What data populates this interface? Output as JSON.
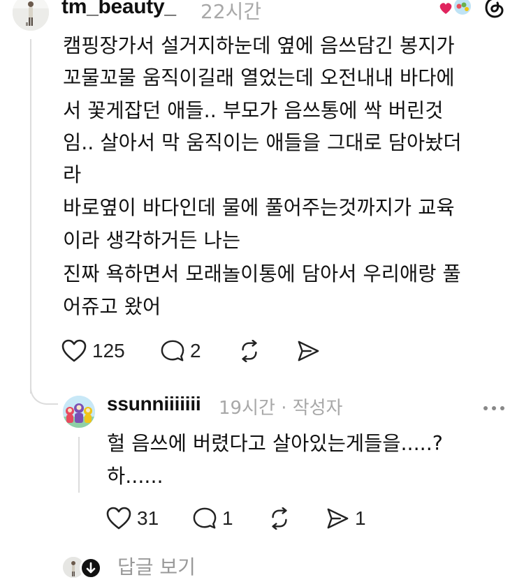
{
  "post": {
    "username": "tm_beauty_",
    "time": "22시간",
    "lines": [
      "캠핑장가서 설거지하눈데 옆에 음쓰담긴 봉지가",
      "꼬물꼬물 움직이길래 열었는데 오전내내 바다에",
      "서 꽃게잡던 애들.. 부모가 음쓰통에 싹 버린것",
      "임.. 살아서 막 움직이는 애들을 그대로 담아놨더",
      "라",
      "바로옆이 바다인데 물에 풀어주는것까지가 교육",
      "이라 생각하거든 나는",
      "진짜 욕하면서 모래놀이통에 담아서 우리애랑 풀",
      "어쥬고 왔어"
    ],
    "actions": {
      "likes": "125",
      "replies": "2",
      "reposts": "",
      "shares": ""
    }
  },
  "reply": {
    "username": "ssunniiiiiii",
    "meta": "19시간 · 작성자",
    "lines": [
      "헐 음쓰에 버렸다고 살아있는게들을.....?",
      "하......"
    ],
    "actions": {
      "likes": "31",
      "replies": "1",
      "reposts": "",
      "shares": "1"
    }
  },
  "view_replies": {
    "label": "답글 보기"
  },
  "colors": {
    "text": "#101010",
    "muted": "#a8a8a8",
    "line": "#dcdcdc",
    "heart": "#e0245e"
  },
  "icons": [
    "heart-icon",
    "comment-icon",
    "repost-icon",
    "share-icon",
    "threads-icon",
    "more-icon",
    "arrow-down-icon"
  ]
}
